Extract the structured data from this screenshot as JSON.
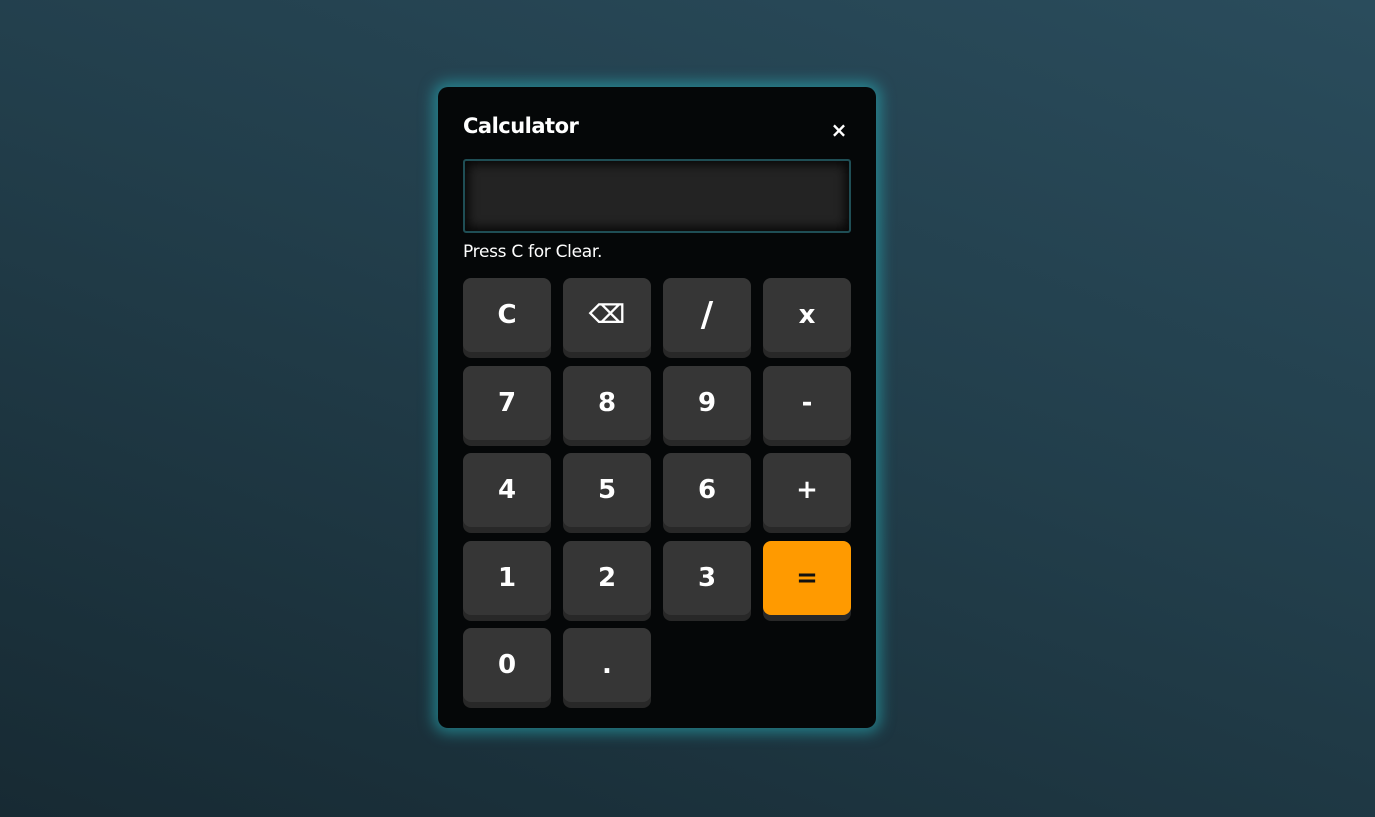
{
  "window": {
    "title": "Calculator",
    "close_label": "×"
  },
  "display": {
    "value": ""
  },
  "hint": "Press C for Clear.",
  "keys": {
    "clear": "C",
    "backspace": "⌫",
    "divide": "/",
    "multiply": "x",
    "seven": "7",
    "eight": "8",
    "nine": "9",
    "minus": "-",
    "four": "4",
    "five": "5",
    "six": "6",
    "plus": "+",
    "one": "1",
    "two": "2",
    "three": "3",
    "equals": "=",
    "zero": "0",
    "dot": "."
  },
  "colors": {
    "accent": "#ff9a00",
    "key": "#363636",
    "panel": "#050708",
    "glow": "#28b4be"
  }
}
